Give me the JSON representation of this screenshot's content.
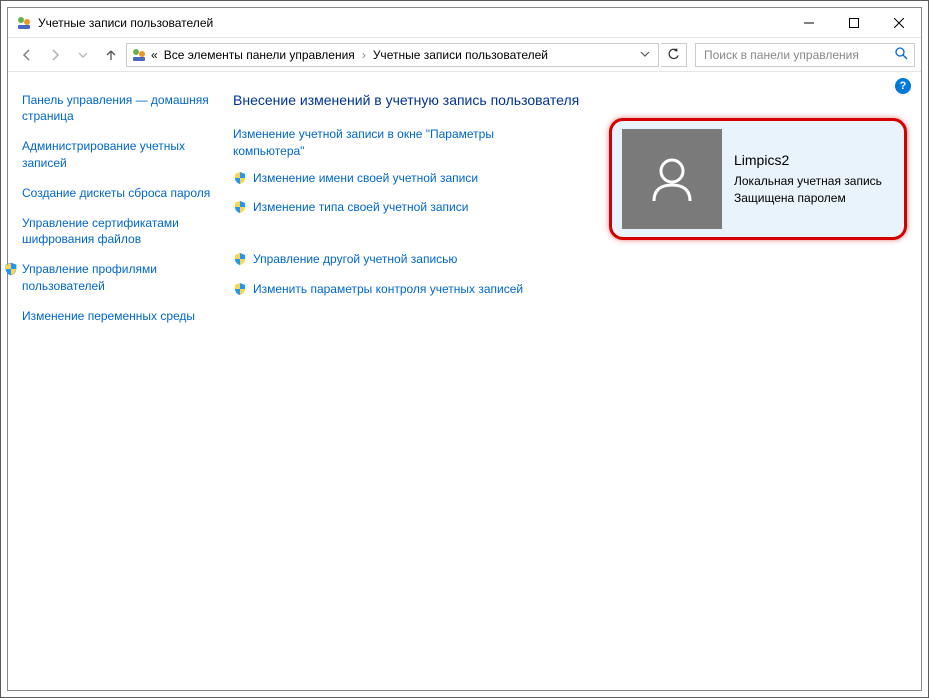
{
  "window": {
    "title": "Учетные записи пользователей"
  },
  "breadcrumb": {
    "root_indicator": "«",
    "item1": "Все элементы панели управления",
    "item2": "Учетные записи пользователей"
  },
  "search": {
    "placeholder": "Поиск в панели управления"
  },
  "sidebar": {
    "items": [
      {
        "label": "Панель управления — домашняя страница",
        "shield": false
      },
      {
        "label": "Администрирование учетных записей",
        "shield": false
      },
      {
        "label": "Создание дискеты сброса пароля",
        "shield": false
      },
      {
        "label": "Управление сертификатами шифрования файлов",
        "shield": false
      },
      {
        "label": "Управление профилями пользователей",
        "shield": true
      },
      {
        "label": "Изменение переменных среды",
        "shield": false
      }
    ]
  },
  "content": {
    "heading": "Внесение изменений в учетную запись пользователя",
    "actions": [
      {
        "label": "Изменение учетной записи в окне \"Параметры компьютера\"",
        "shield": false
      },
      {
        "label": "Изменение имени своей учетной записи",
        "shield": true
      },
      {
        "label": "Изменение типа своей учетной записи",
        "shield": true
      }
    ],
    "actions2": [
      {
        "label": "Управление другой учетной записью",
        "shield": true
      },
      {
        "label": "Изменить параметры контроля учетных записей",
        "shield": true
      }
    ]
  },
  "account": {
    "name": "Limpics2",
    "type": "Локальная учетная запись",
    "protection": "Защищена паролем"
  },
  "help": {
    "symbol": "?"
  }
}
